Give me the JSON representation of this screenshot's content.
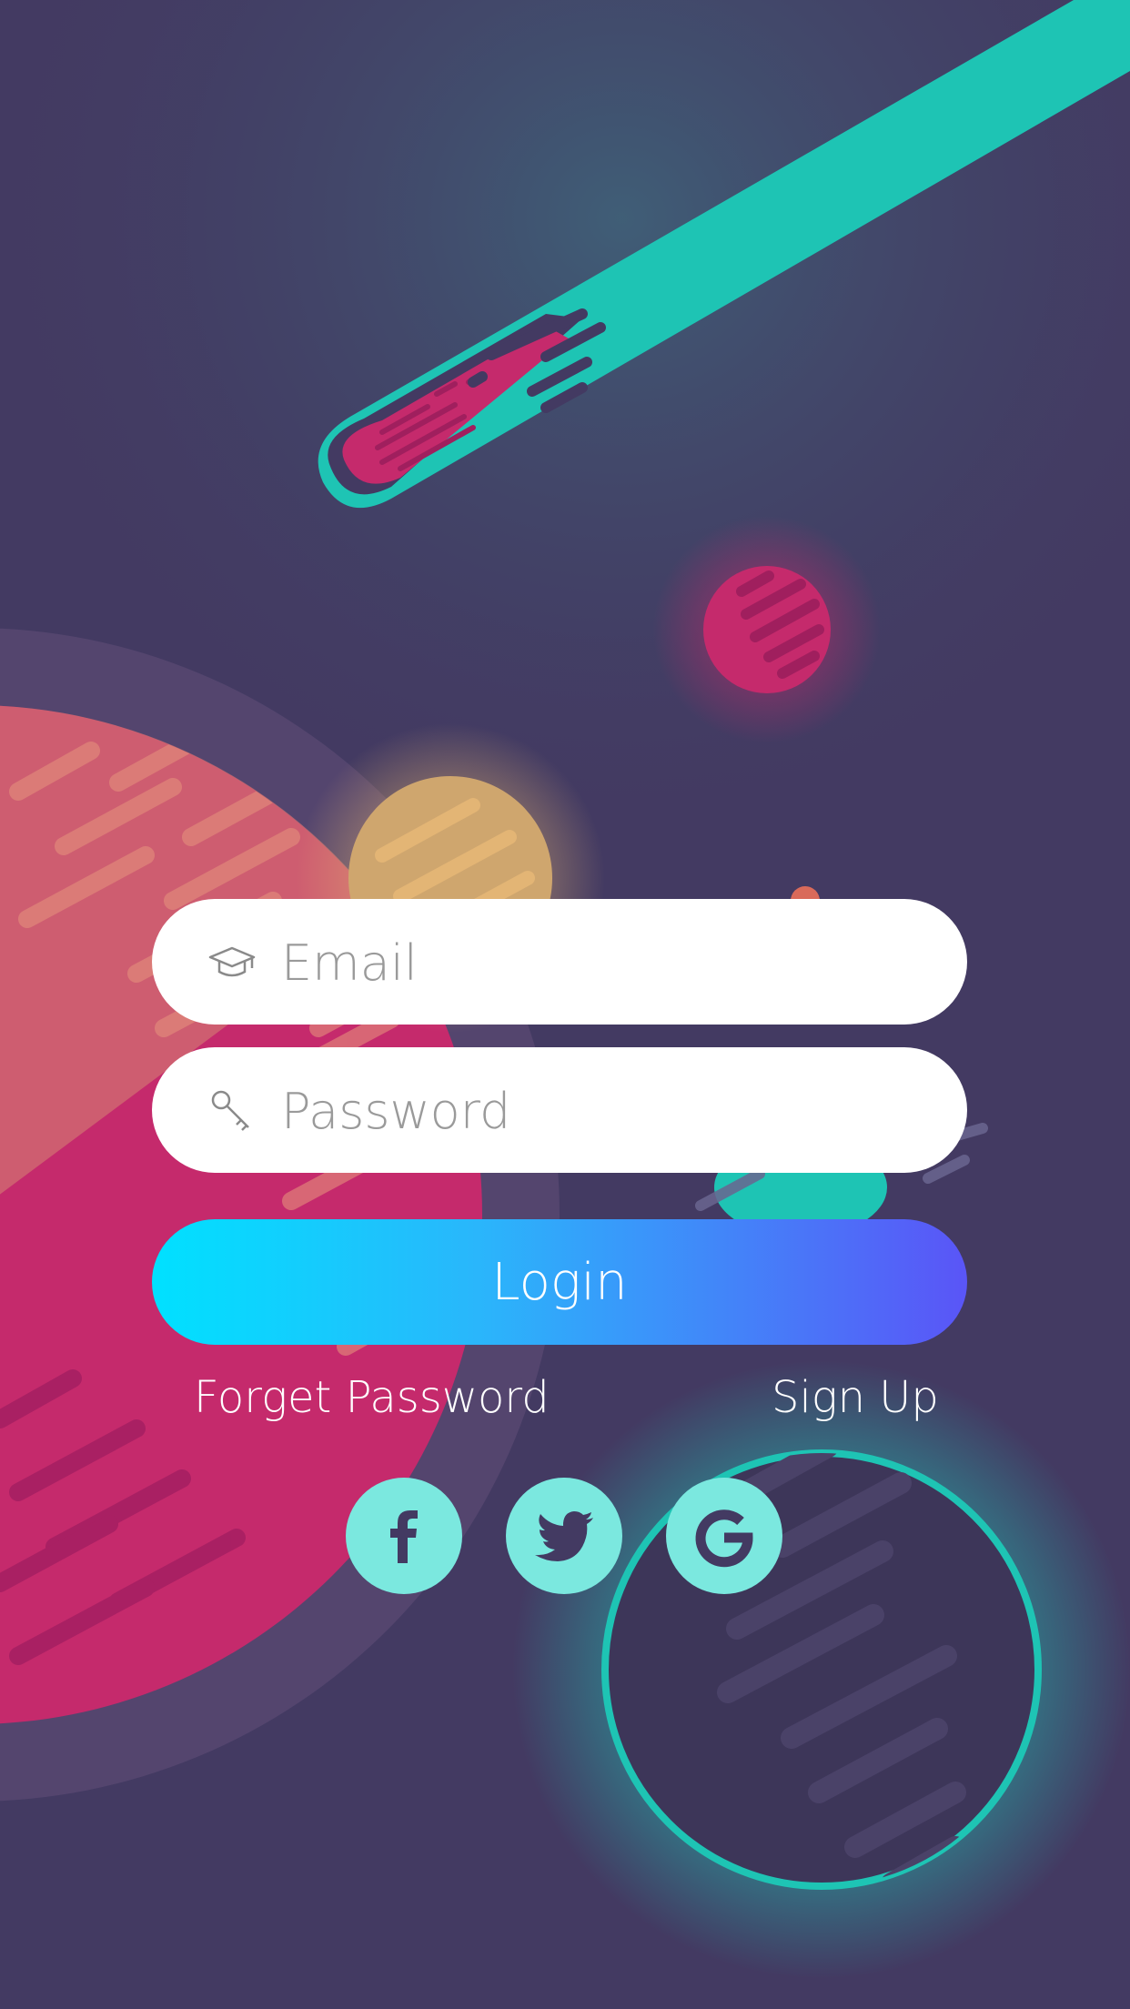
{
  "login_form": {
    "email_placeholder": "Email",
    "password_placeholder": "Password",
    "login_label": "Login",
    "forget_password_label": "Forget Password",
    "sign_up_label": "Sign Up"
  },
  "social_buttons": [
    {
      "icon": "facebook-icon"
    },
    {
      "icon": "twitter-icon"
    },
    {
      "icon": "google-icon"
    }
  ],
  "colors": {
    "background": "#433a62",
    "accent_teal": "#1ec4b4",
    "planet_pink": "#c52a6c",
    "planet_gold": "#d6a76e",
    "social_button": "#7be8df",
    "login_gradient_start": "#00e1ff",
    "login_gradient_end": "#5a55f7"
  }
}
